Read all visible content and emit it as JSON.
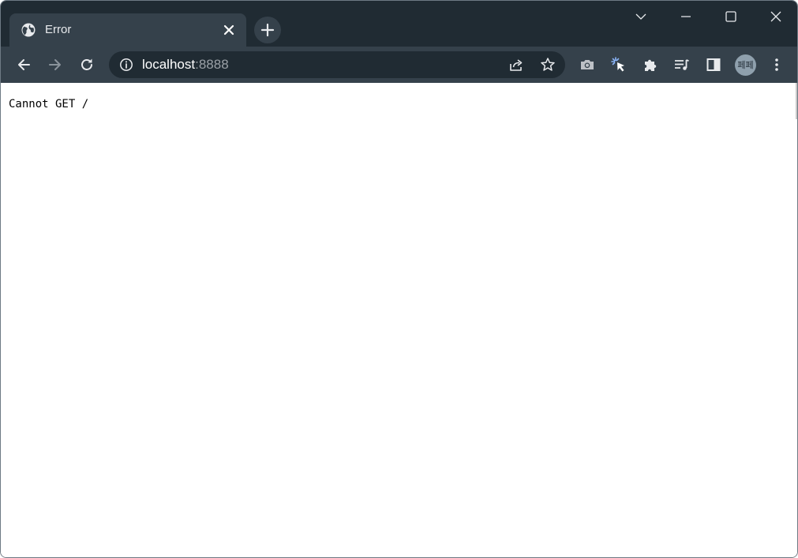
{
  "tab": {
    "title": "Error",
    "favicon": "globe-icon",
    "close_icon": "close-icon"
  },
  "new_tab": {
    "icon": "plus-icon"
  },
  "window_controls": {
    "tab_search_icon": "chevron-down-icon",
    "minimize_icon": "minimize-icon",
    "maximize_icon": "maximize-icon",
    "close_icon": "close-icon"
  },
  "toolbar": {
    "back_icon": "arrow-left-icon",
    "forward_icon": "arrow-right-icon",
    "reload_icon": "reload-icon",
    "address": {
      "host": "localhost",
      "port": ":8888",
      "info_icon": "info-icon",
      "share_icon": "share-icon",
      "bookmark_icon": "star-icon"
    },
    "extensions": [
      "camera-icon",
      "cursor-click-icon",
      "puzzle-icon",
      "media-queue-icon",
      "side-panel-icon"
    ],
    "profile_label": "페페",
    "menu_icon": "kebab-menu-icon"
  },
  "page": {
    "message": "Cannot GET /"
  },
  "colors": {
    "titlebar": "#202b33",
    "toolbar": "#35414b",
    "omnibox": "#202b33",
    "icon": "#e8eaed",
    "accent": "#8ab4f8"
  }
}
